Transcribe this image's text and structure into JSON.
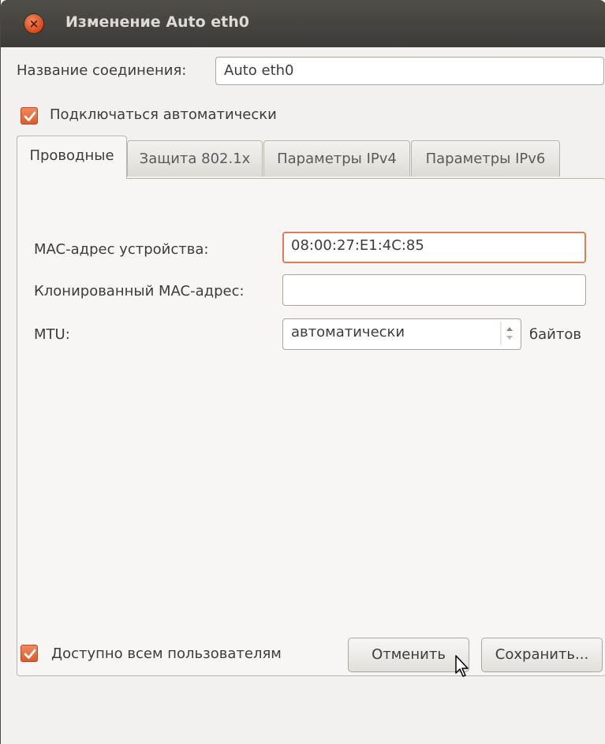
{
  "window": {
    "title": "Изменение Auto eth0"
  },
  "connection": {
    "name_label": "Название соединения:",
    "name_value": "Auto eth0"
  },
  "auto_connect": {
    "label": "Подключаться автоматически",
    "checked": true
  },
  "tabs": [
    {
      "label": "Проводные",
      "active": true
    },
    {
      "label": "Защита 802.1x",
      "active": false
    },
    {
      "label": "Параметры IPv4",
      "active": false
    },
    {
      "label": "Параметры IPv6",
      "active": false
    }
  ],
  "wired": {
    "mac_label": "MAC-адрес устройства:",
    "mac_value": "08:00:27:E1:4C:85",
    "cloned_mac_label": "Клонированный MAC-адрес:",
    "cloned_mac_value": "",
    "mtu_label": "MTU:",
    "mtu_value": "автоматически",
    "mtu_unit": "байтов"
  },
  "all_users": {
    "label": "Доступно всем пользователям",
    "checked": true
  },
  "buttons": {
    "cancel": "Отменить",
    "save": "Сохранить..."
  },
  "icons": {
    "close": "close-icon",
    "check": "checkmark-icon",
    "spin": "spin-arrows-icon",
    "cursor": "mouse-pointer-icon"
  },
  "colors": {
    "accent": "#dd5a2b",
    "titlebar": "#3c3b37",
    "focus_border": "#dd7f52"
  }
}
